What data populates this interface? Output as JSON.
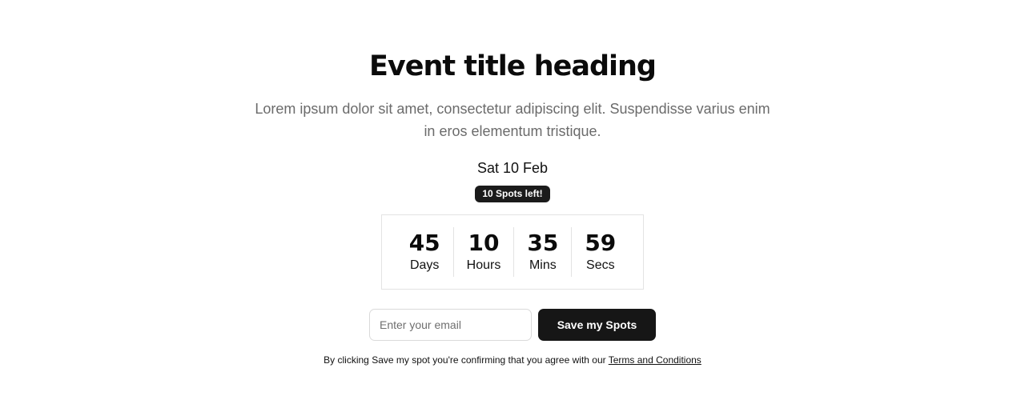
{
  "event": {
    "title": "Event title heading",
    "description": "Lorem ipsum dolor sit amet, consectetur adipiscing elit. Suspendisse varius enim in eros elementum tristique.",
    "date": "Sat 10 Feb",
    "spots_badge": "10 Spots left!"
  },
  "countdown": {
    "days": {
      "value": "45",
      "label": "Days"
    },
    "hours": {
      "value": "10",
      "label": "Hours"
    },
    "mins": {
      "value": "35",
      "label": "Mins"
    },
    "secs": {
      "value": "59",
      "label": "Secs"
    }
  },
  "form": {
    "email_placeholder": "Enter your email",
    "email_value": "",
    "submit_label": "Save my Spots"
  },
  "disclaimer": {
    "text": "By clicking Save my spot you're confirming that you agree with our ",
    "link_label": "Terms and Conditions"
  }
}
